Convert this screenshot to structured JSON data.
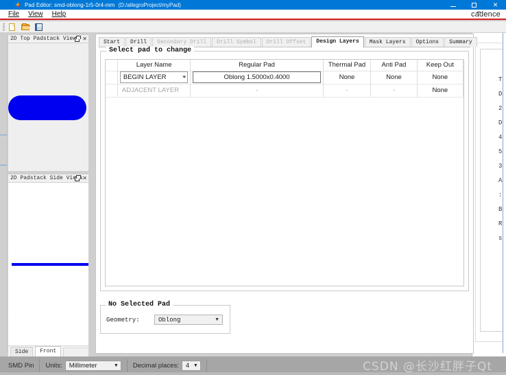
{
  "window": {
    "title": "Pad Editor: smd-oblong-1r5-0r4-mm",
    "path": "(D:/allegroProject/myPad)",
    "app_icon": "cadence-star-icon",
    "minimize_label": "–",
    "maximize_label": "□",
    "close_label": "✕"
  },
  "menu": {
    "items": [
      "File",
      "View",
      "Help"
    ],
    "brand": "cadence"
  },
  "toolbar": {
    "buttons": [
      {
        "name": "new-file-button",
        "icon": "new-file-icon"
      },
      {
        "name": "open-file-button",
        "icon": "open-folder-icon"
      },
      {
        "name": "save-file-button",
        "icon": "save-disk-icon"
      }
    ]
  },
  "panels": {
    "top_view": {
      "title": "2D Top Padstack View",
      "float_icon": "float-panel-icon",
      "close_icon": "close-panel-icon",
      "shape_color": "#0000f0",
      "shape": "oblong-pad-shape"
    },
    "side_views": {
      "title": "2D Padstack Side Views",
      "float_icon": "float-panel-icon",
      "close_icon": "close-panel-icon",
      "shape_color": "#0000f0",
      "tabs": [
        {
          "label": "Side",
          "active": false
        },
        {
          "label": "Front",
          "active": true
        }
      ]
    }
  },
  "main": {
    "tabs": [
      {
        "label": "Start",
        "state": "enabled"
      },
      {
        "label": "Drill",
        "state": "enabled"
      },
      {
        "label": "Secondary Drill",
        "state": "disabled"
      },
      {
        "label": "Drill Symbol",
        "state": "disabled"
      },
      {
        "label": "Drill Offset",
        "state": "disabled"
      },
      {
        "label": "Design Layers",
        "state": "active"
      },
      {
        "label": "Mask Layers",
        "state": "enabled"
      },
      {
        "label": "Options",
        "state": "enabled"
      },
      {
        "label": "Summary",
        "state": "enabled"
      }
    ],
    "select_group_title": "Select pad to change",
    "table": {
      "headers": [
        "",
        "Layer Name",
        "Regular Pad",
        "Thermal Pad",
        "Anti Pad",
        "Keep Out"
      ],
      "rows": [
        {
          "marker": "",
          "layer_name": "BEGIN LAYER",
          "layer_name_is_combo": true,
          "regular_pad": "Oblong 1.5000x0.4000",
          "regular_pad_is_boxed": true,
          "thermal_pad": "None",
          "anti_pad": "None",
          "keep_out": "None",
          "dim": false
        },
        {
          "marker": "",
          "layer_name": "ADJACENT LAYER",
          "layer_name_is_combo": false,
          "regular_pad": "-",
          "regular_pad_is_boxed": false,
          "thermal_pad": "-",
          "anti_pad": "-",
          "keep_out": "None",
          "dim": true
        }
      ]
    },
    "selected_pad": {
      "group_title": "No Selected Pad",
      "geometry_label": "Geometry:",
      "geometry_value": "Oblong",
      "chevron": "▼"
    }
  },
  "status_bar": {
    "pin_type": "SMD Pin",
    "units_label": "Units:",
    "units_value": "Millimeter",
    "decimal_label": "Decimal places:",
    "decimal_value": "4",
    "chevron": "▼",
    "watermark": "CSDN @长沙红胖子Qt"
  }
}
